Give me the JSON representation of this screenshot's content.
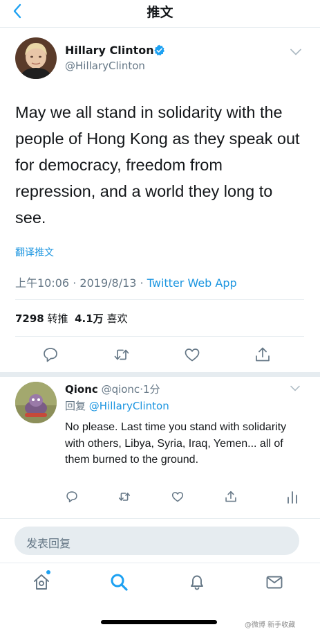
{
  "nav": {
    "title": "推文",
    "back_icon": "chevron-left-icon"
  },
  "tweet": {
    "author_name": "Hillary Clinton",
    "author_handle": "@HillaryClinton",
    "verified": true,
    "text": "May we all stand in solidarity with the people of Hong Kong as they speak out for democracy, freedom from repression, and a world they long to see.",
    "translate_label": "翻译推文",
    "time": "上午10:06",
    "date": "2019/8/13",
    "separator": "·",
    "source": "Twitter Web App",
    "retweet_count": "7298",
    "retweet_label": "转推",
    "like_count": "4.1万",
    "like_label": "喜欢",
    "actions": [
      "reply-icon",
      "retweet-icon",
      "like-icon",
      "share-icon"
    ]
  },
  "reply": {
    "author_name": "Qionc",
    "author_handle": "@qionc",
    "separator": "·",
    "time": "1分",
    "reply_to_prefix": "回复",
    "reply_to_handle": "@HillaryClinton",
    "text": "No please. Last time you stand with solidarity with others, Libya, Syria, Iraq, Yemen... all of them burned to the ground.",
    "actions": [
      "reply-icon",
      "retweet-icon",
      "like-icon",
      "share-icon",
      "analytics-icon"
    ]
  },
  "compose": {
    "placeholder": "发表回复"
  },
  "tabbar": {
    "tabs": [
      "home-icon",
      "search-icon",
      "notifications-icon",
      "messages-icon"
    ],
    "active": "search-icon"
  },
  "watermark": "@微博 新手收藏",
  "colors": {
    "accent": "#1da1f2",
    "link": "#1b95e0",
    "muted": "#657786",
    "divider": "#e6ecf0"
  }
}
